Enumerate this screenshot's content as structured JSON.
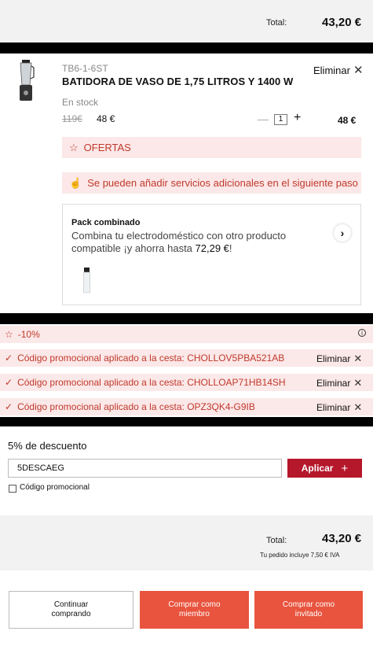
{
  "header": {
    "total_label": "Total:",
    "total_value": "43,20 €"
  },
  "product": {
    "sku": "TB6-1-6ST",
    "name": "BATIDORA DE VASO DE 1,75 LITROS Y 1400 W",
    "remove_label": "Eliminar",
    "stock": "En stock",
    "old_price": "119€",
    "new_price": "48 €",
    "quantity": "1",
    "minus_symbol": "—",
    "plus_symbol": "+",
    "line_total": "48 €",
    "offers_label": "OFERTAS",
    "services_label": "Se pueden añadir servicios adicionales en el siguiente paso"
  },
  "pack": {
    "title": "Pack combinado",
    "description": "Combina tu electrodoméstico con otro producto compatible ¡y ahorra hasta ",
    "amount": "72,29 €",
    "suffix": "!"
  },
  "promos": {
    "discount_label": "-10%",
    "rows": [
      {
        "text": "Código promocional aplicado a la cesta: CHOLLOV5PBA521AB",
        "remove": "Eliminar"
      },
      {
        "text": "Código promocional aplicado a la cesta: CHOLLOAP71HB14SH",
        "remove": "Eliminar"
      },
      {
        "text": "Código promocional aplicado a la cesta: OPZ3QK4-G9IB",
        "remove": "Eliminar"
      }
    ]
  },
  "discount_form": {
    "title": "5% de descuento",
    "input_value": "5DESCAEG",
    "apply_label": "Aplicar",
    "checkbox_label": "Código promocional"
  },
  "summary": {
    "total_label": "Total:",
    "total_value": "43,20 €",
    "iva_note": "Tu pedido incluye 7,50 € IVA"
  },
  "actions": {
    "continue_label": "Continuar\ncomprando",
    "member_label": "Comprar como\nmiembro",
    "guest_label": "Comprar como\ninvitado"
  },
  "colors": {
    "accent_red": "#b5172b",
    "promo_red": "#c0392b",
    "cta_orange": "#e8543e"
  },
  "icons": [
    "star-outline-icon",
    "hand-pointer-icon",
    "chevron-right-icon",
    "check-icon",
    "info-icon",
    "close-icon",
    "plus-icon"
  ]
}
